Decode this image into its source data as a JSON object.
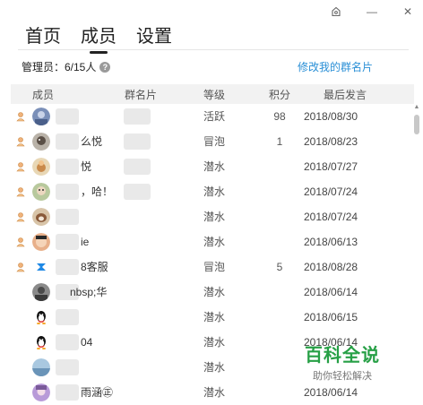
{
  "window": {
    "icons": [
      "settings-icon",
      "minimize-icon",
      "close-icon"
    ],
    "close_glyph": "✕",
    "minimize_glyph": "—"
  },
  "tabs": [
    {
      "label": "首页",
      "active": false
    },
    {
      "label": "成员",
      "active": true
    },
    {
      "label": "设置",
      "active": false
    }
  ],
  "summary": {
    "admin_text": "管理员：6/15人",
    "help_glyph": "?",
    "edit_link": "修改我的群名片"
  },
  "table": {
    "headers": [
      "成员",
      "群名片",
      "等级",
      "积分",
      "最后发言"
    ],
    "rows": [
      {
        "admin": true,
        "avatar": "a1",
        "name": "",
        "card": "",
        "level": "活跃",
        "points": "98",
        "date": "2018/08/30"
      },
      {
        "admin": true,
        "avatar": "a2",
        "name": "么悦",
        "card": "",
        "level": "冒泡",
        "points": "1",
        "date": "2018/08/23"
      },
      {
        "admin": true,
        "avatar": "a3",
        "name": "悦",
        "card": "",
        "level": "潜水",
        "points": "",
        "date": "2018/07/27"
      },
      {
        "admin": true,
        "avatar": "a4",
        "name": "，哈！",
        "card": "",
        "level": "潜水",
        "points": "",
        "date": "2018/07/24"
      },
      {
        "admin": true,
        "avatar": "a5",
        "name": "",
        "card": "",
        "level": "潜水",
        "points": "",
        "date": "2018/07/24"
      },
      {
        "admin": true,
        "avatar": "a6",
        "name": "ie",
        "card": "",
        "level": "潜水",
        "points": "",
        "date": "2018/06/13"
      },
      {
        "admin": true,
        "avatar": "a7",
        "name": "8客服",
        "card": "",
        "level": "冒泡",
        "points": "5",
        "date": "2018/08/28"
      },
      {
        "admin": false,
        "avatar": "a8",
        "name": "nbsp;华",
        "card": "",
        "level": "潜水",
        "points": "",
        "date": "2018/06/14"
      },
      {
        "admin": false,
        "avatar": "qq",
        "name": "",
        "card": "",
        "level": "潜水",
        "points": "",
        "date": "2018/06/15"
      },
      {
        "admin": false,
        "avatar": "qq",
        "name": "04",
        "card": "",
        "level": "潜水",
        "points": "",
        "date": "2018/06/14"
      },
      {
        "admin": false,
        "avatar": "a11",
        "name": "",
        "card": "",
        "level": "潜水",
        "points": "",
        "date": ""
      },
      {
        "admin": false,
        "avatar": "a12",
        "name": "雨涵㊣",
        "card": "",
        "level": "潜水",
        "points": "",
        "date": "2018/06/14"
      }
    ]
  },
  "watermark": {
    "title": "百科全说",
    "subtitle": "助你轻松解决"
  },
  "colors": {
    "link": "#2a8fd6",
    "watermark": "#27a046",
    "header_bg": "#f2f2f2"
  }
}
